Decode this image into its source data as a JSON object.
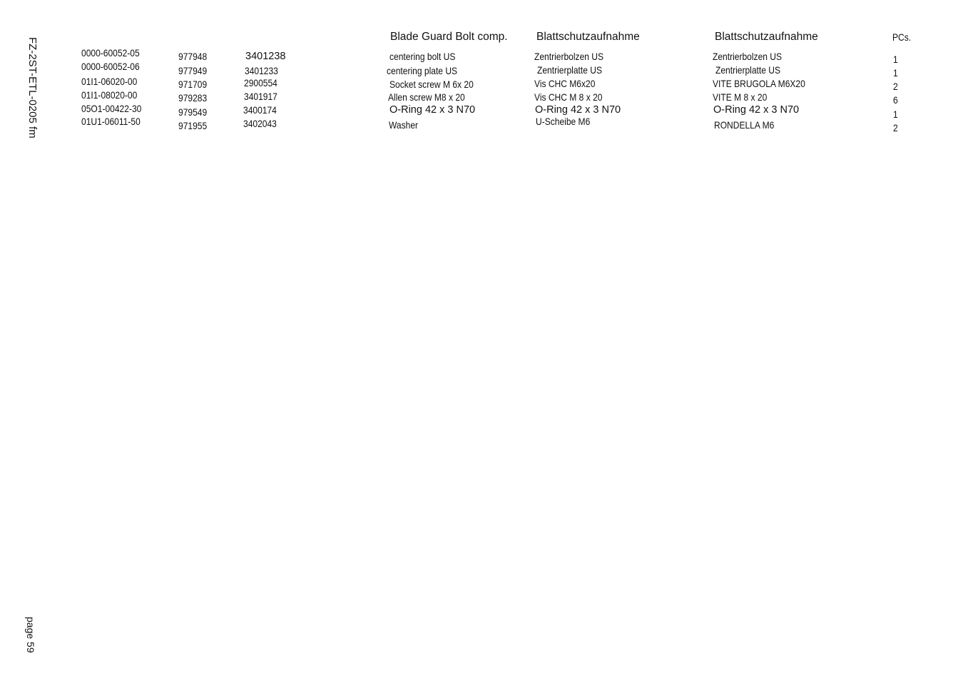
{
  "document_id": "FZ-2ST-ETL-0205 fm",
  "page_label": "page 59",
  "headers": {
    "english": "Blade Guard Bolt comp.",
    "german": "Blattschutzaufnahme",
    "third": "Blattschutzaufnahme",
    "pcs": "PCs."
  },
  "rows": [
    {
      "code": "0000-60052-05",
      "num1": "977948",
      "num2": "3401238",
      "english": "centering bolt US",
      "german": "Zentrierbolzen US",
      "third": "Zentrierbolzen US",
      "pcs": "1"
    },
    {
      "code": "0000-60052-06",
      "num1": "977949",
      "num2": "3401233",
      "english": "centering plate US",
      "german": "Zentrierplatte US",
      "third": "Zentrierplatte US",
      "pcs": "1"
    },
    {
      "code": "01I1-06020-00",
      "num1": "971709",
      "num2": "2900554",
      "english": "Socket screw M 6x 20",
      "german": "Vis CHC M6x20",
      "third": "VITE BRUGOLA M6X20",
      "pcs": "2"
    },
    {
      "code": "01I1-08020-00",
      "num1": "979283",
      "num2": "3401917",
      "english": "Allen screw M8 x 20",
      "german": "Vis CHC M 8 x 20",
      "third": "VITE M 8 x 20",
      "pcs": "6"
    },
    {
      "code": "05O1-00422-30",
      "num1": "979549",
      "num2": "3400174",
      "english": "O-Ring 42 x 3 N70",
      "german": "O-Ring 42 x 3 N70",
      "third": "O-Ring 42 x 3 N70",
      "pcs": "1"
    },
    {
      "code": "01U1-06011-50",
      "num1": "971955",
      "num2": "3402043",
      "english": "Washer",
      "german": "U-Scheibe M6",
      "third": "RONDELLA M6",
      "pcs": "2"
    }
  ]
}
